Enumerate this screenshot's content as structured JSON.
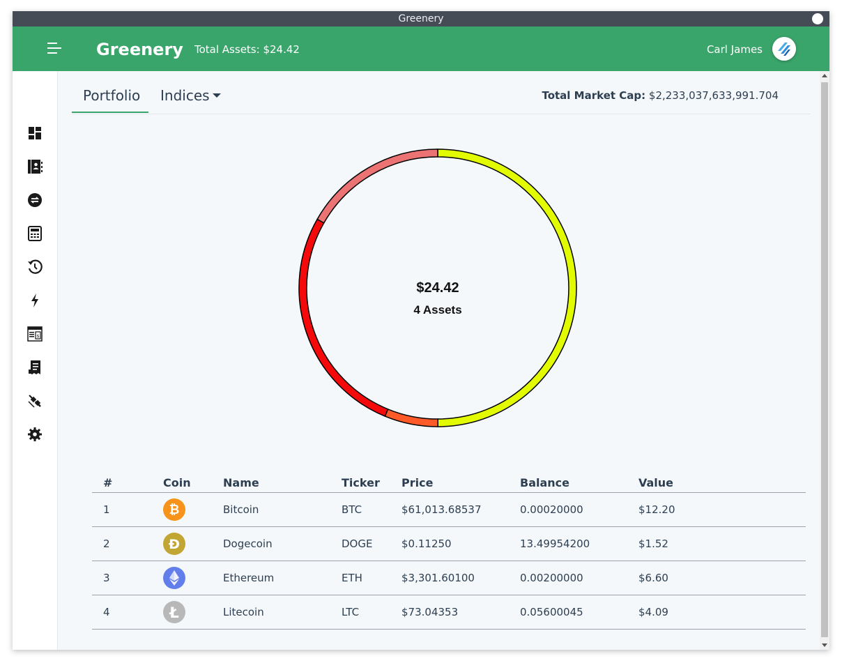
{
  "window": {
    "title": "Greenery"
  },
  "header": {
    "brand": "Greenery",
    "total_assets": "Total Assets: $24.42",
    "user_name": "Carl James",
    "accent_color": "#3aa56b"
  },
  "sidebar": {
    "items": [
      {
        "icon": "dashboard-icon"
      },
      {
        "icon": "address-book-icon"
      },
      {
        "icon": "exchange-icon"
      },
      {
        "icon": "calculator-icon"
      },
      {
        "icon": "history-icon"
      },
      {
        "icon": "lightning-icon"
      },
      {
        "icon": "invoice-icon"
      },
      {
        "icon": "receipt-icon"
      },
      {
        "icon": "plugin-icon"
      },
      {
        "icon": "gear-icon"
      }
    ]
  },
  "tabs": [
    {
      "label": "Portfolio",
      "active": true
    },
    {
      "label": "Indices",
      "active": false
    }
  ],
  "market_cap": {
    "label": "Total Market Cap:",
    "value": "$2,233,037,633,991.704"
  },
  "chart_data": {
    "type": "pie",
    "style": "donut",
    "center_total": "$24.42",
    "center_count": "4 Assets",
    "slices": [
      {
        "name": "Bitcoin",
        "value": 12.2,
        "color": "#e2fb00"
      },
      {
        "name": "Dogecoin",
        "value": 1.52,
        "color": "#ff5a28"
      },
      {
        "name": "Ethereum",
        "value": 6.6,
        "color": "#f40a0a"
      },
      {
        "name": "Litecoin",
        "value": 4.09,
        "color": "#eb7373"
      }
    ]
  },
  "table": {
    "headers": [
      "#",
      "Coin",
      "Name",
      "Ticker",
      "Price",
      "Balance",
      "Value"
    ],
    "rows": [
      {
        "num": "1",
        "coin_icon": "bitcoin-icon",
        "coin_color": "#f7931a",
        "name": "Bitcoin",
        "ticker": "BTC",
        "price": "$61,013.68537",
        "balance": "0.00020000",
        "value": "$12.20"
      },
      {
        "num": "2",
        "coin_icon": "dogecoin-icon",
        "coin_color": "#c2a633",
        "name": "Dogecoin",
        "ticker": "DOGE",
        "price": "$0.11250",
        "balance": "13.49954200",
        "value": "$1.52"
      },
      {
        "num": "3",
        "coin_icon": "ethereum-icon",
        "coin_color": "#627eea",
        "name": "Ethereum",
        "ticker": "ETH",
        "price": "$3,301.60100",
        "balance": "0.00200000",
        "value": "$6.60"
      },
      {
        "num": "4",
        "coin_icon": "litecoin-icon",
        "coin_color": "#b8b8b8",
        "name": "Litecoin",
        "ticker": "LTC",
        "price": "$73.04353",
        "balance": "0.05600045",
        "value": "$4.09"
      }
    ]
  }
}
